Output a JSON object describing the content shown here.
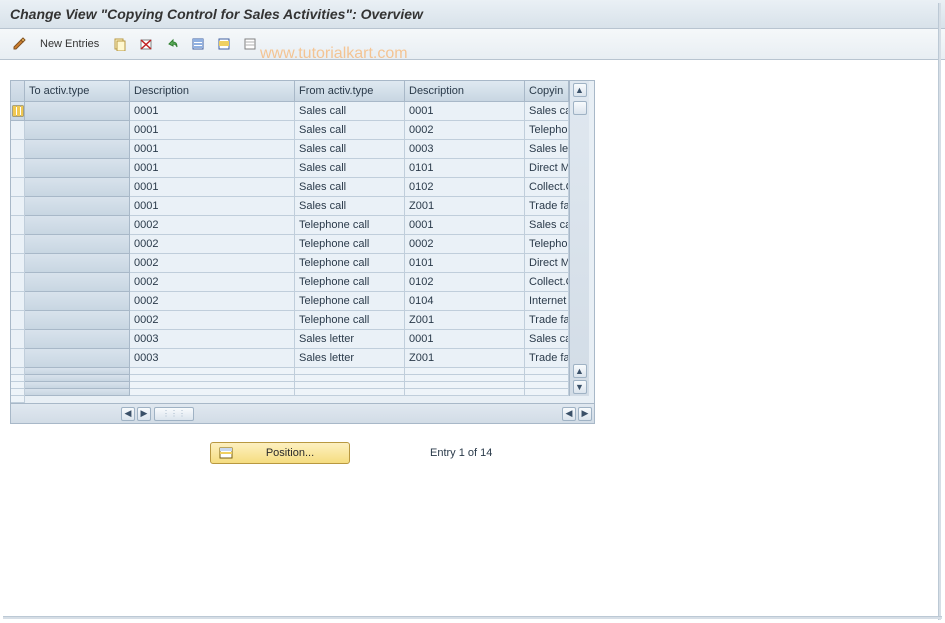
{
  "title": "Change View \"Copying Control for Sales Activities\": Overview",
  "watermark": "www.tutorialkart.com",
  "toolbar": {
    "new_entries": "New Entries"
  },
  "table": {
    "headers": {
      "to_type": "To activ.type",
      "desc1": "Description",
      "from_type": "From activ.type",
      "desc2": "Description",
      "copying": "Copyin"
    },
    "rows": [
      {
        "to": "0001",
        "d1": "Sales call",
        "from": "0001",
        "d2": "Sales call",
        "c": ""
      },
      {
        "to": "0001",
        "d1": "Sales call",
        "from": "0002",
        "d2": "Telephone call",
        "c": ""
      },
      {
        "to": "0001",
        "d1": "Sales call",
        "from": "0003",
        "d2": "Sales letter",
        "c": ""
      },
      {
        "to": "0001",
        "d1": "Sales call",
        "from": "0101",
        "d2": "Direct Mailing",
        "c": ""
      },
      {
        "to": "0001",
        "d1": "Sales call",
        "from": "0102",
        "d2": "Collect.Gen.Sls Acts",
        "c": ""
      },
      {
        "to": "0001",
        "d1": "Sales call",
        "from": "Z001",
        "d2": "Trade fair contact",
        "c": ""
      },
      {
        "to": "0002",
        "d1": "Telephone call",
        "from": "0001",
        "d2": "Sales call",
        "c": ""
      },
      {
        "to": "0002",
        "d1": "Telephone call",
        "from": "0002",
        "d2": "Telephone call",
        "c": ""
      },
      {
        "to": "0002",
        "d1": "Telephone call",
        "from": "0101",
        "d2": "Direct Mailing",
        "c": ""
      },
      {
        "to": "0002",
        "d1": "Telephone call",
        "from": "0102",
        "d2": "Collect.Gen.Sls Acts",
        "c": ""
      },
      {
        "to": "0002",
        "d1": "Telephone call",
        "from": "0104",
        "d2": "Internet mailing",
        "c": ""
      },
      {
        "to": "0002",
        "d1": "Telephone call",
        "from": "Z001",
        "d2": "Trade fair contact",
        "c": ""
      },
      {
        "to": "0003",
        "d1": "Sales letter",
        "from": "0001",
        "d2": "Sales call",
        "c": ""
      },
      {
        "to": "0003",
        "d1": "Sales letter",
        "from": "Z001",
        "d2": "Trade fair contact",
        "c": ""
      }
    ],
    "empty_rows": 4
  },
  "footer": {
    "position_label": "Position...",
    "entry_text": "Entry 1 of 14"
  }
}
